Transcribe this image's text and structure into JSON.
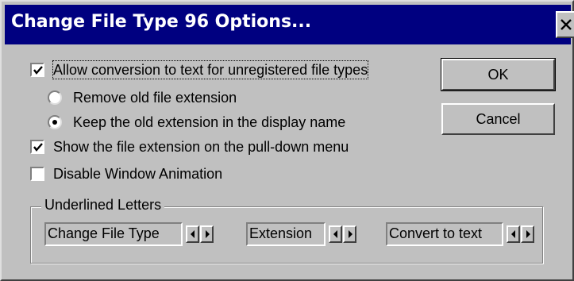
{
  "window": {
    "title": "Change File Type 96 Options..."
  },
  "options": {
    "allow_conversion": {
      "label": "Allow conversion to text for unregistered file types",
      "checked": true
    },
    "remove_extension": {
      "label": "Remove old file extension",
      "selected": false
    },
    "keep_extension": {
      "label": "Keep the old extension in the display name",
      "selected": true
    },
    "show_extension": {
      "label": "Show the file extension on the pull-down menu",
      "checked": true
    },
    "disable_animation": {
      "label": "Disable Window Animation",
      "checked": false
    }
  },
  "buttons": {
    "ok": "OK",
    "cancel": "Cancel"
  },
  "underlined_letters": {
    "label": "Underlined Letters",
    "fields": [
      {
        "value": "Change File Type"
      },
      {
        "value": "Extension"
      },
      {
        "value": "Convert to text"
      }
    ]
  }
}
